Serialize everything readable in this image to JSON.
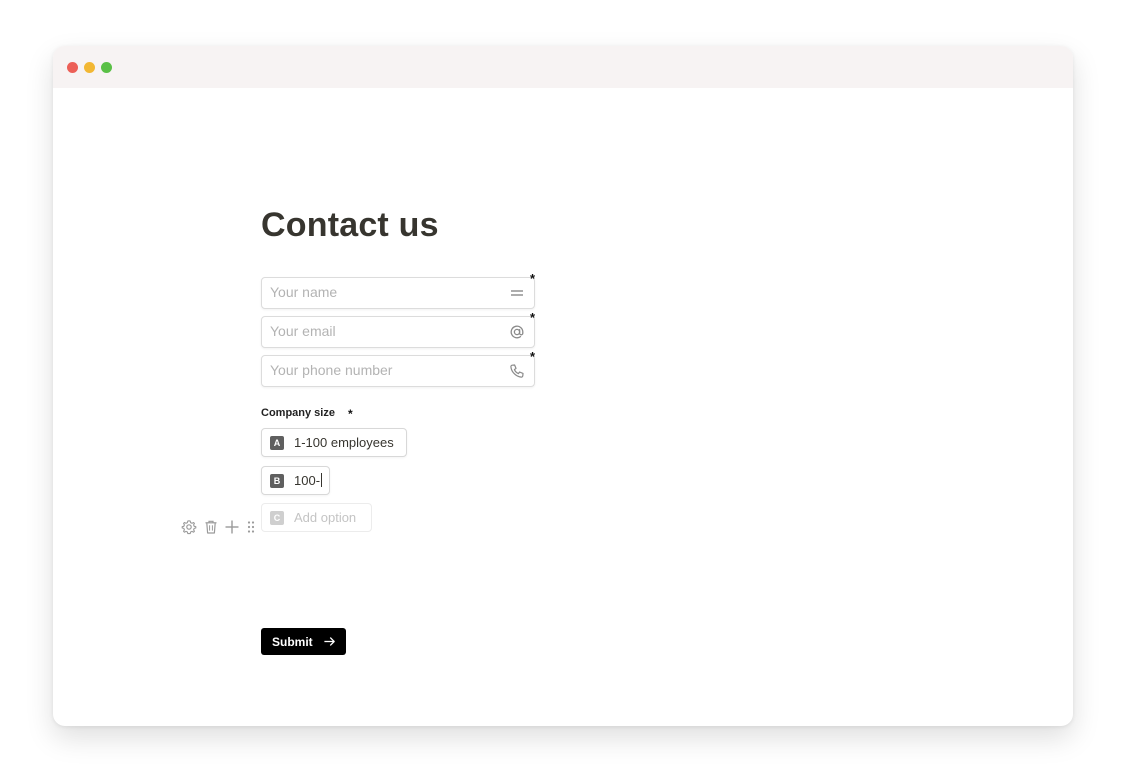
{
  "window": {
    "controls": [
      "close",
      "minimize",
      "maximize"
    ],
    "colors": {
      "close": "#ec5f57",
      "minimize": "#f2b733",
      "maximize": "#5ac046"
    }
  },
  "form": {
    "title": "Contact us",
    "fields": {
      "name": {
        "placeholder": "Your name",
        "icon": "short-text-icon",
        "required_mark": "*"
      },
      "email": {
        "placeholder": "Your email",
        "icon": "at-sign-icon",
        "required_mark": "*"
      },
      "phone": {
        "placeholder": "Your phone number",
        "icon": "phone-icon",
        "required_mark": "*"
      }
    },
    "company_size": {
      "label": "Company size",
      "required_mark": "*",
      "options": [
        {
          "key": "A",
          "label": "1-100 employees"
        },
        {
          "key": "B",
          "label": "100-"
        }
      ],
      "add_option": {
        "key": "C",
        "label": "Add option"
      }
    },
    "block_tools": [
      "settings-icon",
      "trash-icon",
      "plus-icon",
      "drag-handle-icon"
    ],
    "submit": {
      "label": "Submit",
      "icon": "arrow-right-icon"
    }
  }
}
